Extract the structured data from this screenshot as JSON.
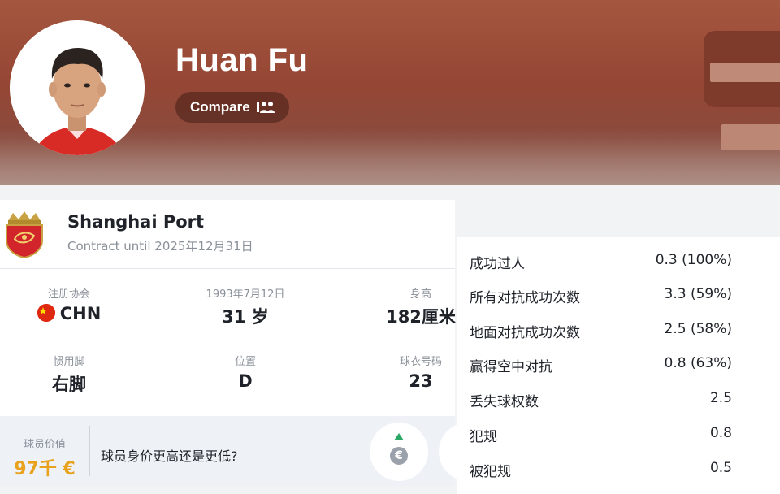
{
  "header": {
    "player_name": "Huan Fu",
    "compare_label": "Compare",
    "bg_color": "#964634"
  },
  "club": {
    "name": "Shanghai Port",
    "contract": "Contract until 2025年12月31日"
  },
  "info": [
    {
      "label": "注册协会",
      "value": "CHN"
    },
    {
      "label": "1993年7月12日",
      "value": "31 岁"
    },
    {
      "label": "身高",
      "value": "182厘米"
    },
    {
      "label": "惯用脚",
      "value": "右脚"
    },
    {
      "label": "位置",
      "value": "D"
    },
    {
      "label": "球衣号码",
      "value": "23"
    }
  ],
  "market": {
    "label": "球员价值",
    "value": "97千 €",
    "question": "球员身价更高还是更低?",
    "value_color": "#e8a21e"
  },
  "stats": [
    {
      "name": "成功过人",
      "value": "0.3 (100%)"
    },
    {
      "name": "所有对抗成功次数",
      "value": "3.3 (59%)"
    },
    {
      "name": "地面对抗成功次数",
      "value": "2.5 (58%)"
    },
    {
      "name": "赢得空中对抗",
      "value": "0.8 (63%)"
    },
    {
      "name": "丢失球权数",
      "value": "2.5"
    },
    {
      "name": "犯规",
      "value": "0.8"
    },
    {
      "name": "被犯规",
      "value": "0.5"
    }
  ]
}
